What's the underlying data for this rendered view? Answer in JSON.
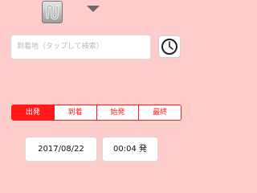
{
  "header": {
    "app_icon": "transfer-route-icon",
    "dropdown_icon": "triangle-down-icon"
  },
  "search": {
    "placeholder": "到着地（タップして検索）",
    "clock_icon": "clock-icon"
  },
  "segments": [
    {
      "label": "出発",
      "active": true
    },
    {
      "label": "到着",
      "active": false
    },
    {
      "label": "始発",
      "active": false
    },
    {
      "label": "最終",
      "active": false
    }
  ],
  "datetime": {
    "date": "2017/08/22",
    "time": "00:04 発"
  },
  "colors": {
    "background": "#ffcccc",
    "accent": "#ff1a1a"
  }
}
